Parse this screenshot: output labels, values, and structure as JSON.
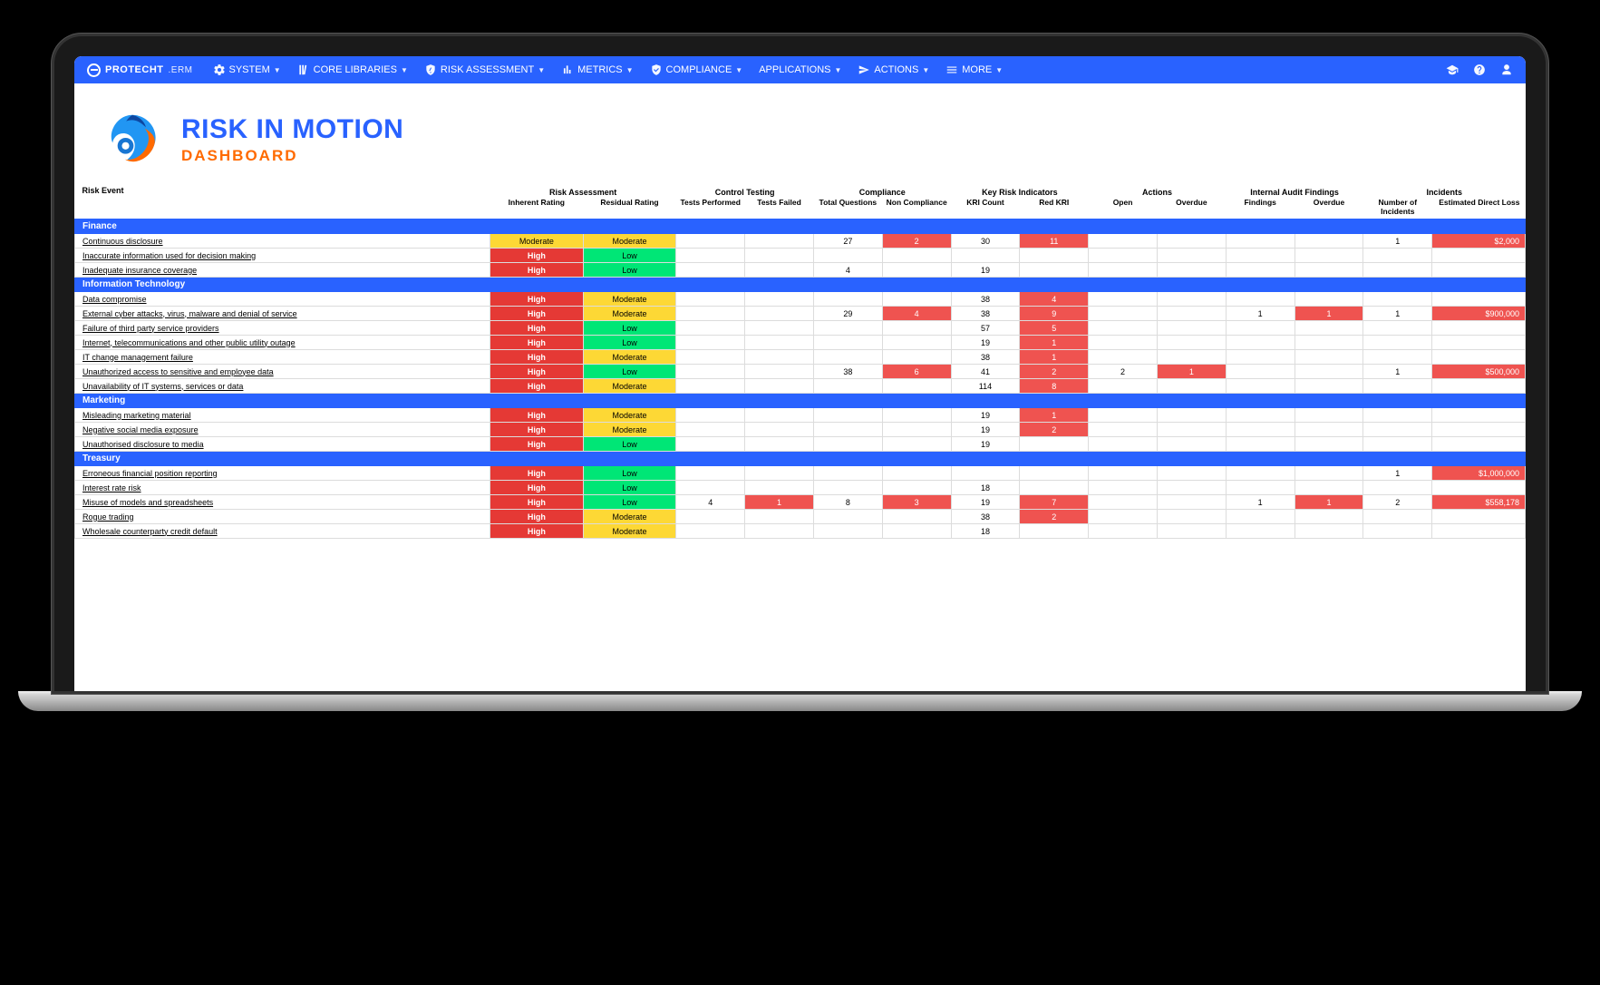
{
  "brand": {
    "main": "PROTECHT",
    "suffix": ".ERM"
  },
  "nav": {
    "items": [
      "SYSTEM",
      "CORE LIBRARIES",
      "RISK ASSESSMENT",
      "METRICS",
      "COMPLIANCE",
      "APPLICATIONS",
      "ACTIONS",
      "MORE"
    ]
  },
  "header": {
    "title": "RISK IN MOTION",
    "subtitle": "DASHBOARD"
  },
  "column_groups": [
    {
      "label": "Risk Event",
      "span": 1,
      "subs": [
        ""
      ]
    },
    {
      "label": "Risk Assessment",
      "span": 2,
      "subs": [
        "Inherent Rating",
        "Residual Rating"
      ]
    },
    {
      "label": "Control Testing",
      "span": 2,
      "subs": [
        "Tests Performed",
        "Tests Failed"
      ]
    },
    {
      "label": "Compliance",
      "span": 2,
      "subs": [
        "Total Questions",
        "Non Compliance"
      ]
    },
    {
      "label": "Key Risk Indicators",
      "span": 2,
      "subs": [
        "KRI Count",
        "Red KRI"
      ]
    },
    {
      "label": "Actions",
      "span": 2,
      "subs": [
        "Open",
        "Overdue"
      ]
    },
    {
      "label": "Internal Audit Findings",
      "span": 2,
      "subs": [
        "Findings",
        "Overdue"
      ]
    },
    {
      "label": "Incidents",
      "span": 2,
      "subs": [
        "Number of Incidents",
        "Estimated Direct Loss"
      ]
    }
  ],
  "sections": [
    {
      "name": "Finance",
      "rows": [
        {
          "name": "Continuous disclosure",
          "inherent": "Moderate",
          "residual": "Moderate",
          "tests_perf": "",
          "tests_fail": "",
          "total_q": "27",
          "noncomp": "2",
          "kri": "30",
          "red_kri": "11",
          "open": "",
          "overdue": "",
          "findings": "",
          "foverdue": "",
          "incidents": "1",
          "loss": "$2,000"
        },
        {
          "name": "Inaccurate information used for decision making",
          "inherent": "High",
          "residual": "Low",
          "tests_perf": "",
          "tests_fail": "",
          "total_q": "",
          "noncomp": "",
          "kri": "",
          "red_kri": "",
          "open": "",
          "overdue": "",
          "findings": "",
          "foverdue": "",
          "incidents": "",
          "loss": ""
        },
        {
          "name": "Inadequate insurance coverage",
          "inherent": "High",
          "residual": "Low",
          "tests_perf": "",
          "tests_fail": "",
          "total_q": "4",
          "noncomp": "",
          "kri": "19",
          "red_kri": "",
          "open": "",
          "overdue": "",
          "findings": "",
          "foverdue": "",
          "incidents": "",
          "loss": ""
        }
      ]
    },
    {
      "name": "Information Technology",
      "rows": [
        {
          "name": "Data compromise",
          "inherent": "High",
          "residual": "Moderate",
          "tests_perf": "",
          "tests_fail": "",
          "total_q": "",
          "noncomp": "",
          "kri": "38",
          "red_kri": "4",
          "open": "",
          "overdue": "",
          "findings": "",
          "foverdue": "",
          "incidents": "",
          "loss": ""
        },
        {
          "name": "External cyber attacks, virus, malware and denial of service",
          "inherent": "High",
          "residual": "Moderate",
          "tests_perf": "",
          "tests_fail": "",
          "total_q": "29",
          "noncomp": "4",
          "kri": "38",
          "red_kri": "9",
          "open": "",
          "overdue": "",
          "findings": "1",
          "foverdue": "1",
          "incidents": "1",
          "loss": "$900,000"
        },
        {
          "name": "Failure of third party service providers",
          "inherent": "High",
          "residual": "Low",
          "tests_perf": "",
          "tests_fail": "",
          "total_q": "",
          "noncomp": "",
          "kri": "57",
          "red_kri": "5",
          "open": "",
          "overdue": "",
          "findings": "",
          "foverdue": "",
          "incidents": "",
          "loss": ""
        },
        {
          "name": "Internet, telecommunications and other public utility outage",
          "inherent": "High",
          "residual": "Low",
          "tests_perf": "",
          "tests_fail": "",
          "total_q": "",
          "noncomp": "",
          "kri": "19",
          "red_kri": "1",
          "open": "",
          "overdue": "",
          "findings": "",
          "foverdue": "",
          "incidents": "",
          "loss": ""
        },
        {
          "name": "IT change management failure",
          "inherent": "High",
          "residual": "Moderate",
          "tests_perf": "",
          "tests_fail": "",
          "total_q": "",
          "noncomp": "",
          "kri": "38",
          "red_kri": "1",
          "open": "",
          "overdue": "",
          "findings": "",
          "foverdue": "",
          "incidents": "",
          "loss": ""
        },
        {
          "name": "Unauthorized access to sensitive and employee data",
          "inherent": "High",
          "residual": "Low",
          "tests_perf": "",
          "tests_fail": "",
          "total_q": "38",
          "noncomp": "6",
          "kri": "41",
          "red_kri": "2",
          "open": "2",
          "overdue": "1",
          "findings": "",
          "foverdue": "",
          "incidents": "1",
          "loss": "$500,000"
        },
        {
          "name": "Unavailability of IT systems, services or data",
          "inherent": "High",
          "residual": "Moderate",
          "tests_perf": "",
          "tests_fail": "",
          "total_q": "",
          "noncomp": "",
          "kri": "114",
          "red_kri": "8",
          "open": "",
          "overdue": "",
          "findings": "",
          "foverdue": "",
          "incidents": "",
          "loss": ""
        }
      ]
    },
    {
      "name": "Marketing",
      "rows": [
        {
          "name": "Misleading marketing material",
          "inherent": "High",
          "residual": "Moderate",
          "tests_perf": "",
          "tests_fail": "",
          "total_q": "",
          "noncomp": "",
          "kri": "19",
          "red_kri": "1",
          "open": "",
          "overdue": "",
          "findings": "",
          "foverdue": "",
          "incidents": "",
          "loss": ""
        },
        {
          "name": "Negative social media exposure",
          "inherent": "High",
          "residual": "Moderate",
          "tests_perf": "",
          "tests_fail": "",
          "total_q": "",
          "noncomp": "",
          "kri": "19",
          "red_kri": "2",
          "open": "",
          "overdue": "",
          "findings": "",
          "foverdue": "",
          "incidents": "",
          "loss": ""
        },
        {
          "name": "Unauthorised disclosure to media",
          "inherent": "High",
          "residual": "Low",
          "tests_perf": "",
          "tests_fail": "",
          "total_q": "",
          "noncomp": "",
          "kri": "19",
          "red_kri": "",
          "open": "",
          "overdue": "",
          "findings": "",
          "foverdue": "",
          "incidents": "",
          "loss": ""
        }
      ]
    },
    {
      "name": "Treasury",
      "rows": [
        {
          "name": "Erroneous financial position reporting",
          "inherent": "High",
          "residual": "Low",
          "tests_perf": "",
          "tests_fail": "",
          "total_q": "",
          "noncomp": "",
          "kri": "",
          "red_kri": "",
          "open": "",
          "overdue": "",
          "findings": "",
          "foverdue": "",
          "incidents": "1",
          "loss": "$1,000,000"
        },
        {
          "name": "Interest rate risk",
          "inherent": "High",
          "residual": "Low",
          "tests_perf": "",
          "tests_fail": "",
          "total_q": "",
          "noncomp": "",
          "kri": "18",
          "red_kri": "",
          "open": "",
          "overdue": "",
          "findings": "",
          "foverdue": "",
          "incidents": "",
          "loss": ""
        },
        {
          "name": "Misuse of models and spreadsheets",
          "inherent": "High",
          "residual": "Low",
          "tests_perf": "4",
          "tests_fail": "1",
          "total_q": "8",
          "noncomp": "3",
          "kri": "19",
          "red_kri": "7",
          "open": "",
          "overdue": "",
          "findings": "1",
          "foverdue": "1",
          "incidents": "2",
          "loss": "$558,178"
        },
        {
          "name": "Rogue trading",
          "inherent": "High",
          "residual": "Moderate",
          "tests_perf": "",
          "tests_fail": "",
          "total_q": "",
          "noncomp": "",
          "kri": "38",
          "red_kri": "2",
          "open": "",
          "overdue": "",
          "findings": "",
          "foverdue": "",
          "incidents": "",
          "loss": ""
        },
        {
          "name": "Wholesale counterparty credit default",
          "inherent": "High",
          "residual": "Moderate",
          "tests_perf": "",
          "tests_fail": "",
          "total_q": "",
          "noncomp": "",
          "kri": "18",
          "red_kri": "",
          "open": "",
          "overdue": "",
          "findings": "",
          "foverdue": "",
          "incidents": "",
          "loss": ""
        }
      ]
    }
  ],
  "red_cells": [
    "noncomp",
    "red_kri",
    "overdue",
    "foverdue",
    "tests_fail",
    "loss"
  ],
  "rating_colors": {
    "High": "cell-high",
    "Moderate": "cell-moderate",
    "Low": "cell-low"
  }
}
